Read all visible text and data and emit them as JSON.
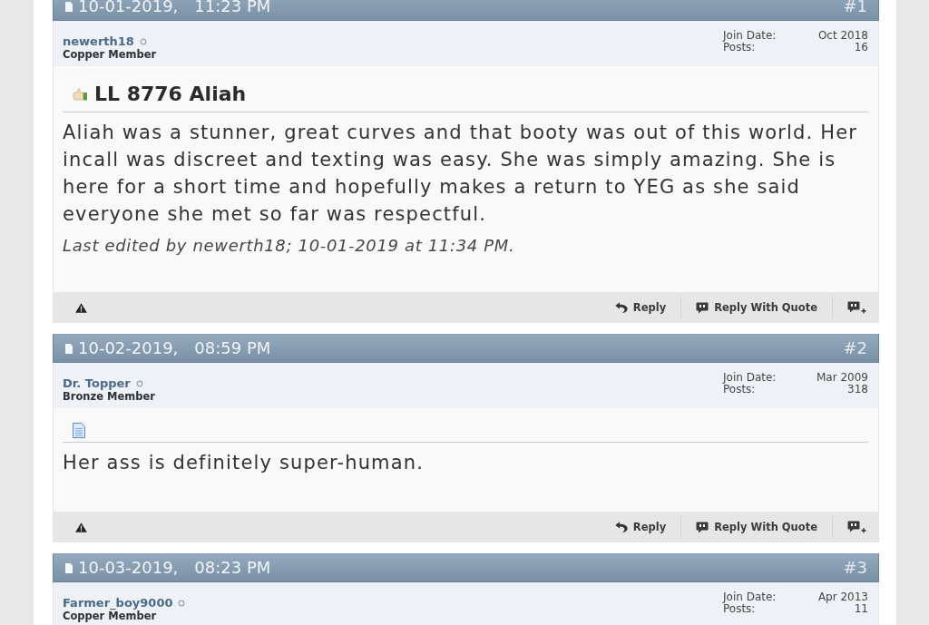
{
  "posts": [
    {
      "date": "10-01-2019,",
      "time": "11:23 PM",
      "number": "#1",
      "author": {
        "username": "newerth18",
        "online": false,
        "rank": "Copper Member"
      },
      "stats": [
        {
          "label": "Join Date:",
          "value": "Oct 2018"
        },
        {
          "label": "Posts:",
          "value": "16"
        }
      ],
      "title_icon": {
        "kind": "hand"
      },
      "title": "LL 8776 Aliah",
      "body": "Aliah was a stunner, great curves and that booty was out of this world. Her incall was discreet and texting was easy. She was simply amazing. She is here for a short time and hopefully makes a return to YEG as she said everyone she met so far was respectful.",
      "edit_note": "Last edited by newerth18; 10-01-2019 at 11:34 PM.",
      "actions": [
        {
          "kind": "reply",
          "label": "Reply"
        },
        {
          "kind": "quote",
          "label": "Reply With Quote"
        }
      ]
    },
    {
      "date": "10-02-2019,",
      "time": "08:59 PM",
      "number": "#2",
      "author": {
        "username": "Dr. Topper",
        "online": false,
        "rank": "Bronze Member"
      },
      "stats": [
        {
          "label": "Join Date:",
          "value": "Mar 2009"
        },
        {
          "label": "Posts:",
          "value": "318"
        }
      ],
      "title_icon": {
        "kind": "document"
      },
      "body": "Her ass is definitely super-human.",
      "actions": [
        {
          "kind": "reply",
          "label": "Reply"
        },
        {
          "kind": "quote",
          "label": "Reply With Quote"
        }
      ]
    },
    {
      "date": "10-03-2019,",
      "time": "08:23 PM",
      "number": "#3",
      "author": {
        "username": "Farmer_boy9000",
        "online": false,
        "rank": "Copper Member"
      },
      "stats": [
        {
          "label": "Join Date:",
          "value": "Apr 2013"
        },
        {
          "label": "Posts:",
          "value": "11"
        }
      ]
    }
  ]
}
